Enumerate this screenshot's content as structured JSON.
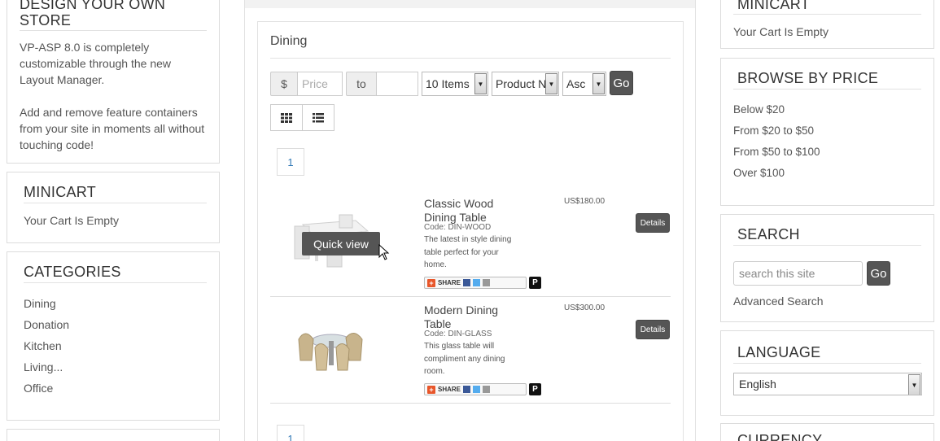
{
  "design": {
    "title": "DESIGN YOUR OWN STORE",
    "para1": "VP-ASP 8.0 is completely customizable through the new Layout Manager.",
    "para2": "Add and remove feature containers from your site in moments all without touching code!"
  },
  "minicart_left": {
    "title": "MINICART",
    "text": "Your Cart Is Empty"
  },
  "categories": {
    "title": "CATEGORIES",
    "items": [
      "Dining",
      "Donation",
      "Kitchen",
      "Living...",
      "Office"
    ]
  },
  "main": {
    "title": "Dining",
    "filter": {
      "currency": "$",
      "price_placeholder": "Price",
      "to_label": "to",
      "items_select": "10 Items",
      "sort_select": "Product N",
      "order_select": "Asc",
      "go": "Go"
    },
    "page_top": "1",
    "page_bottom": "1",
    "products": [
      {
        "name": "Classic Wood Dining Table",
        "code": "Code: DIN-WOOD",
        "desc": "The latest in style dining table perfect for your home.",
        "price": "US$180.00",
        "details": "Details",
        "quick_view": "Quick view",
        "share": "SHARE"
      },
      {
        "name": "Modern Dining Table",
        "code": "Code: DIN-GLASS",
        "desc": "This glass table will compliment any dining room.",
        "price": "US$300.00",
        "details": "Details",
        "share": "SHARE"
      }
    ]
  },
  "minicart_right": {
    "title": "MINICART",
    "text": "Your Cart Is Empty"
  },
  "browse": {
    "title": "BROWSE BY PRICE",
    "items": [
      "Below $20",
      "From $20 to $50",
      "From $50 to $100",
      "Over $100"
    ]
  },
  "search": {
    "title": "SEARCH",
    "placeholder": "search this site",
    "go": "Go",
    "advanced": "Advanced Search"
  },
  "language": {
    "title": "LANGUAGE",
    "selected": "English"
  },
  "currency": {
    "title": "CURRENCY"
  },
  "colors": {
    "button_dark": "#555555",
    "link_blue": "#337ab7",
    "border": "#dcdcdc"
  }
}
